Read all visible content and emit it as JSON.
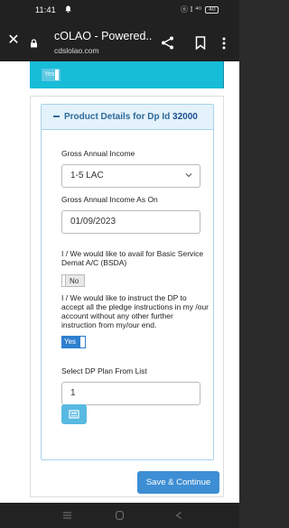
{
  "status_bar": {
    "time": "11:41",
    "right_icons": "ⓞ 𝕀 ⁴ᴳ",
    "battery": "40"
  },
  "browser": {
    "page_title": "cOLAO - Powered...",
    "url": "cdslolao.com"
  },
  "prev_section": {
    "toggle_label": "Yes"
  },
  "product_details": {
    "header_prefix": "Product Details for Dp Id",
    "dp_id": "32000",
    "gross_income_label": "Gross Annual Income",
    "gross_income_value": "1-5 LAC",
    "income_as_on_label": "Gross Annual Income As On",
    "income_as_on_value": "01/09/2023",
    "bsda_label": "I / We would like to avail for Basic Service Demat A/C (BSDA)",
    "bsda_toggle": "No",
    "pledge_label": "I / We would like to instruct the DP to accept all the pledge instructions in my /our account without any other further instruction from my/our end.",
    "pledge_toggle": "Yes",
    "dp_plan_label": "Select DP Plan From List",
    "dp_plan_value": "1"
  },
  "actions": {
    "save_continue": "Save & Continue"
  },
  "colors": {
    "accent": "#17bcd7",
    "primary": "#3d8ed4",
    "header_text": "#2d6a99"
  }
}
